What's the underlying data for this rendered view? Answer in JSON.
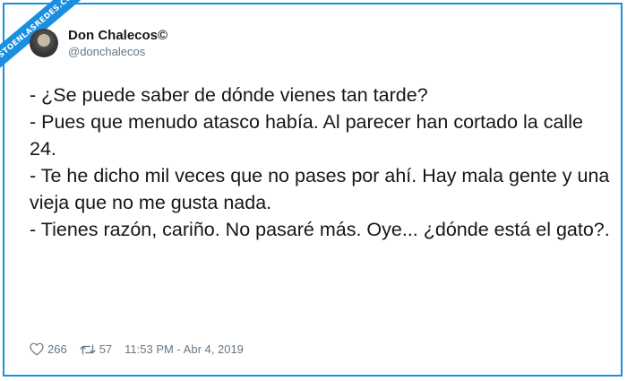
{
  "watermark": {
    "text": "VISTOENLASREDES.COM"
  },
  "author": {
    "display_name": "Don Chalecos©",
    "handle": "@donchalecos"
  },
  "tweet": {
    "lines": [
      "- ¿Se puede saber de dónde vienes tan tarde?",
      "- Pues que menudo atasco había. Al parecer han cortado la calle 24.",
      "- Te he dicho mil veces que no pases por ahí. Hay mala gente y una vieja que no me gusta nada.",
      "- Tienes razón, cariño. No pasaré más. Oye... ¿dónde está el gato?."
    ]
  },
  "footer": {
    "likes": "266",
    "retweets": "57",
    "timestamp": "11:53 PM - Abr 4, 2019",
    "like_icon": "heart-icon",
    "retweet_icon": "retweet-icon"
  },
  "colors": {
    "frame": "#1a8fe0",
    "text": "#14171a",
    "muted": "#657786"
  }
}
